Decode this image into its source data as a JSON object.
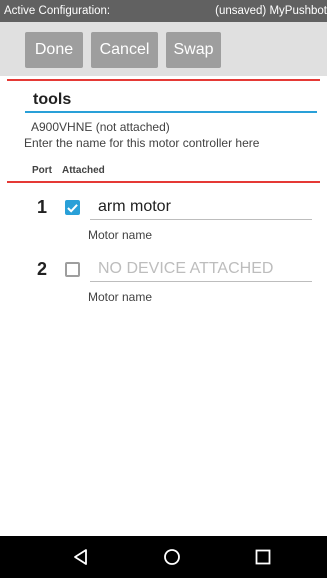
{
  "status_bar": {
    "left_text": "Active Configuration:",
    "right_text": "(unsaved) MyPushbot"
  },
  "toolbar": {
    "done_label": "Done",
    "cancel_label": "Cancel",
    "swap_label": "Swap"
  },
  "controller": {
    "name": "tools",
    "serial": "A900VHNE (not attached)",
    "hint": "Enter the name for this motor controller here"
  },
  "table": {
    "port_header": "Port",
    "attached_header": "Attached",
    "rows": [
      {
        "port": "1",
        "attached": true,
        "motor_name": "arm motor",
        "motor_label": "Motor name"
      },
      {
        "port": "2",
        "attached": false,
        "motor_name": "NO DEVICE ATTACHED",
        "motor_label": "Motor name"
      }
    ]
  },
  "nav_bar": {
    "icons": [
      "back-icon",
      "home-icon",
      "recents-icon"
    ]
  },
  "colors": {
    "accent": "#29a0d8",
    "divider_red": "#e53935",
    "button_gray": "#9e9e9e",
    "toolbar_bg": "#e0e0e0",
    "status_bg": "#616161"
  }
}
